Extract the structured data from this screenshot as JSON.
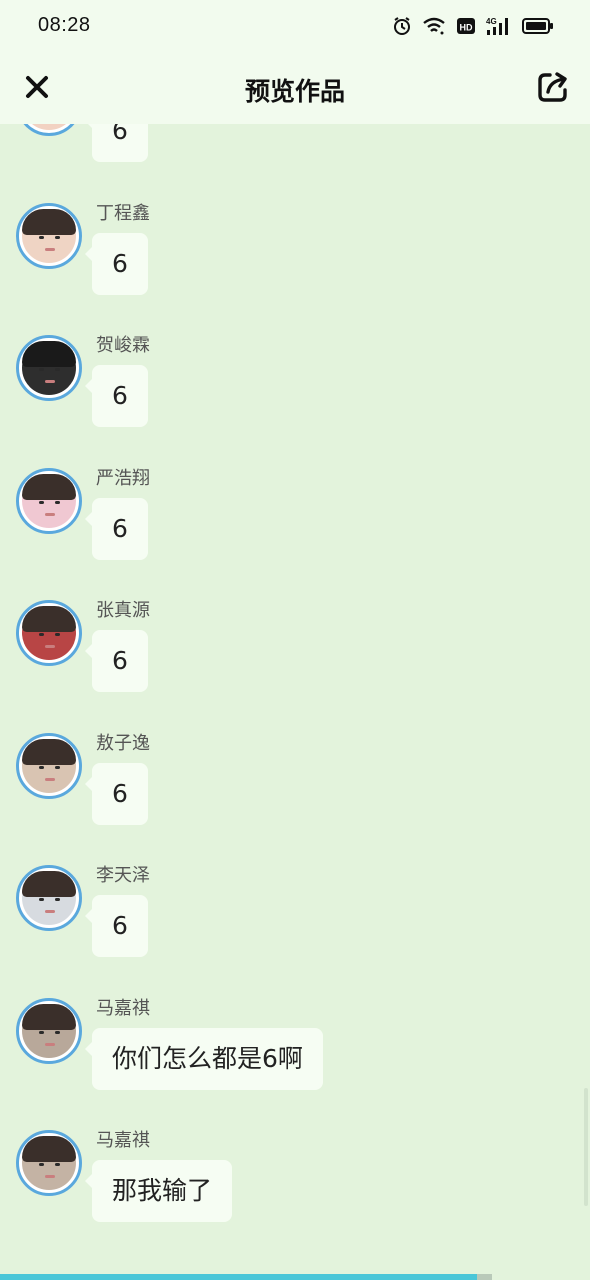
{
  "status_bar": {
    "time": "08:28",
    "icons": [
      "alarm-icon",
      "wifi-icon",
      "hd-icon",
      "signal-4g-icon",
      "battery-icon"
    ]
  },
  "header": {
    "title": "预览作品",
    "close_icon": "close-icon",
    "share_icon": "share-icon"
  },
  "messages": [
    {
      "sender": "",
      "text": "6",
      "avatar_color": "#f2d2c2"
    },
    {
      "sender": "丁程鑫",
      "text": "6",
      "avatar_color": "#efd4c4"
    },
    {
      "sender": "贺峻霖",
      "text": "6",
      "avatar_color": "#2e2e2e"
    },
    {
      "sender": "严浩翔",
      "text": "6",
      "avatar_color": "#f0c8d2"
    },
    {
      "sender": "张真源",
      "text": "6",
      "avatar_color": "#b84545"
    },
    {
      "sender": "敖子逸",
      "text": "6",
      "avatar_color": "#d9c4b2"
    },
    {
      "sender": "李天泽",
      "text": "6",
      "avatar_color": "#d7dbe0"
    },
    {
      "sender": "马嘉祺",
      "text": "你们怎么都是6啊",
      "avatar_color": "#b8a89a"
    },
    {
      "sender": "马嘉祺",
      "text": "那我输了",
      "avatar_color": "#c4b3a4"
    }
  ],
  "progress": 0.97,
  "colors": {
    "background": "#e3f3dc",
    "bubble": "#f6fdf3",
    "avatar_ring": "#5aa8dd",
    "progress": "#4ac6d8"
  }
}
